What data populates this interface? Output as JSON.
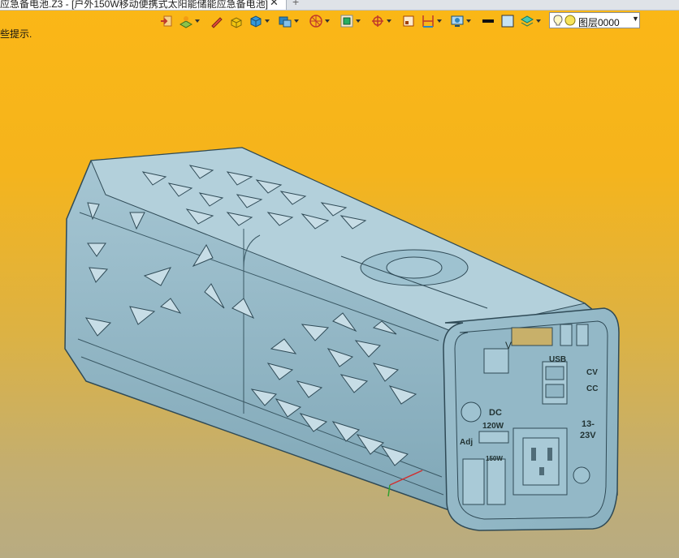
{
  "window": {
    "tab_title": "应急备电池.Z3 - [户外150W移动便携式太阳能储能应急备电池]",
    "tab_close": "✕",
    "tab_new": "+"
  },
  "viewport": {
    "hint_text": "些提示."
  },
  "toolbar": {
    "tools": [
      {
        "icon": "exit-sketch-icon",
        "dropdown": false
      },
      {
        "icon": "sketch-plane-icon",
        "dropdown": true
      },
      {
        "icon": "pencil-icon",
        "dropdown": false
      },
      {
        "icon": "solid-box-icon",
        "dropdown": false
      },
      {
        "icon": "shaded-cube-icon",
        "dropdown": true
      },
      {
        "icon": "display-mode-icon",
        "dropdown": true
      },
      {
        "icon": "view-orient-icon",
        "dropdown": true
      },
      {
        "icon": "zoom-fit-icon",
        "dropdown": true
      },
      {
        "icon": "snap-icon",
        "dropdown": true
      },
      {
        "icon": "frame-icon",
        "dropdown": false
      },
      {
        "icon": "measure-icon",
        "dropdown": true
      },
      {
        "icon": "render-icon",
        "dropdown": true
      },
      {
        "icon": "line-color-icon",
        "dropdown": false
      },
      {
        "icon": "fill-color-icon",
        "dropdown": false
      },
      {
        "icon": "layers-icon",
        "dropdown": true
      }
    ],
    "layer_name": "图层0000",
    "layer_dropdown": "▼"
  },
  "model_labels": {
    "usb": "USB",
    "cv": "CV",
    "cc": "CC",
    "dc": "DC",
    "dc_watts": "120W",
    "adj": "Adj",
    "ac_watts": "150W",
    "voltage_range_top": "13-",
    "voltage_range_bottom": "23V",
    "v_mark": "V"
  },
  "colors": {
    "background_top": "#fbb716",
    "background_bottom": "#b8ab82",
    "model_fill": "#8db4c4",
    "model_stroke": "#2f4a56"
  }
}
